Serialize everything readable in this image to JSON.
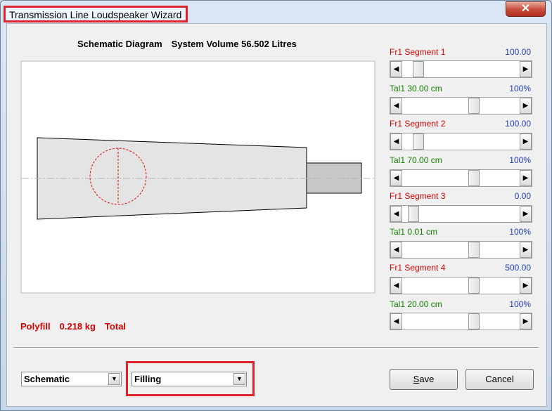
{
  "window": {
    "title": "Transmission Line Loudspeaker Wizard",
    "close_glyph": "✕"
  },
  "diagram": {
    "title": "Schematic Diagram",
    "volume": "System Volume 56.502 Litres"
  },
  "polyfill": {
    "label": "Polyfill",
    "amount": "0.218 kg",
    "scope": "Total"
  },
  "segments": [
    {
      "label": "Fr1  Segment 1",
      "value": "100.00",
      "fraction": 0.1
    },
    {
      "label": "Tal1  30.00 cm",
      "value": "100%",
      "fraction": 0.62
    },
    {
      "label": "Fr1  Segment 2",
      "value": "100.00",
      "fraction": 0.1
    },
    {
      "label": "Tal1  70.00 cm",
      "value": "100%",
      "fraction": 0.62
    },
    {
      "label": "Fr1  Segment 3",
      "value": "0.00",
      "fraction": 0.05
    },
    {
      "label": "Tal1  0.01 cm",
      "value": "100%",
      "fraction": 0.62
    },
    {
      "label": "Fr1  Segment 4",
      "value": "500.00",
      "fraction": 0.62
    },
    {
      "label": "Tal1  20.00 cm",
      "value": "100%",
      "fraction": 0.62
    }
  ],
  "controls": {
    "view_select": "Schematic",
    "mode_select": "Filling",
    "save_label_underlined": "S",
    "save_label_rest": "ave",
    "cancel_label": "Cancel"
  },
  "colors": {
    "highlight": "#e2212b",
    "fr_label": "#d40000",
    "tal_label": "#168000",
    "value": "#1f3dbd"
  }
}
